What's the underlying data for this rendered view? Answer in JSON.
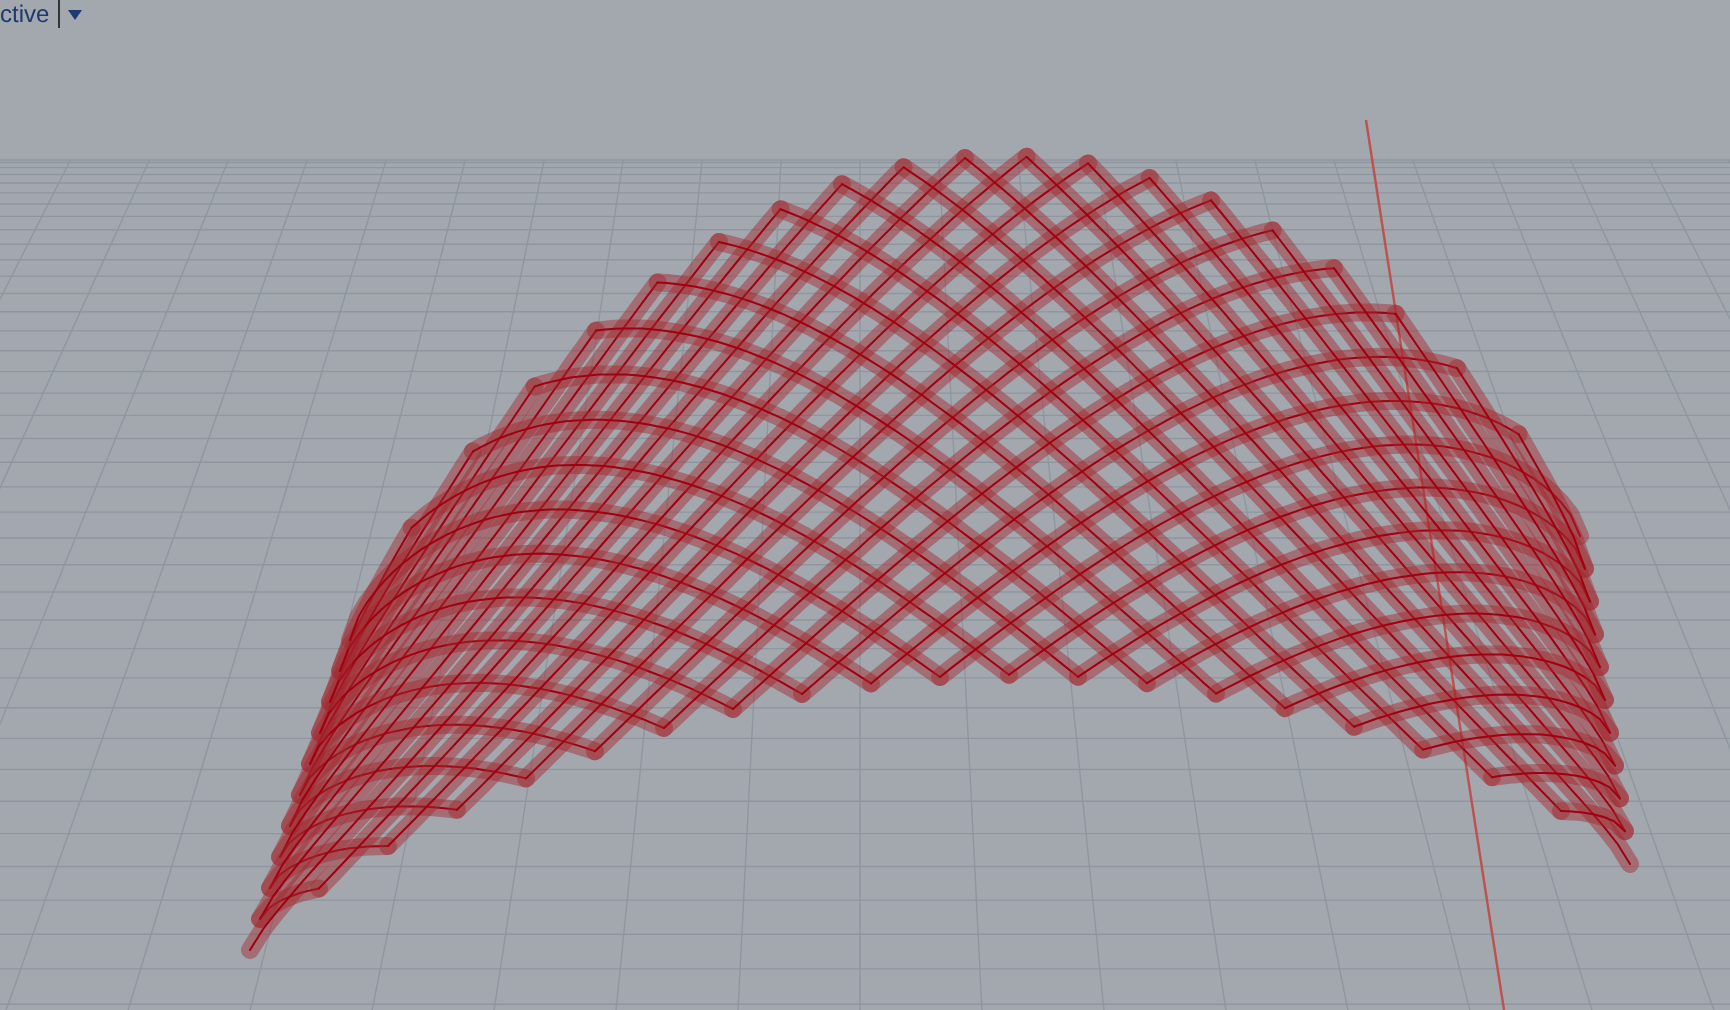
{
  "viewport": {
    "label": "ctive"
  }
}
